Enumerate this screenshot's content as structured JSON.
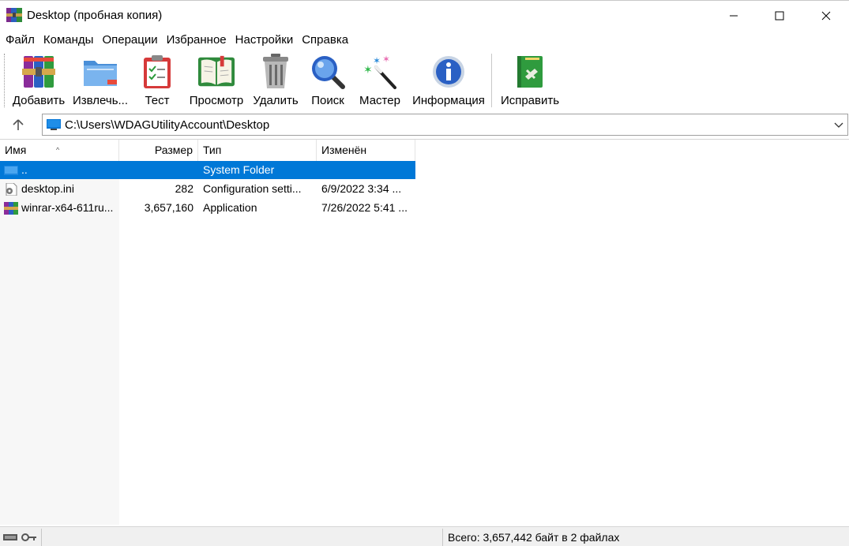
{
  "window": {
    "title": "Desktop (пробная копия)"
  },
  "menu": [
    "Файл",
    "Команды",
    "Операции",
    "Избранное",
    "Настройки",
    "Справка"
  ],
  "toolbar": {
    "add": "Добавить",
    "extract": "Извлечь...",
    "test": "Тест",
    "view": "Просмотр",
    "delete": "Удалить",
    "find": "Поиск",
    "wizard": "Мастер",
    "info": "Информация",
    "repair": "Исправить"
  },
  "address": {
    "path": "C:\\Users\\WDAGUtilityAccount\\Desktop"
  },
  "columns": {
    "name": "Имя",
    "size": "Размер",
    "type": "Тип",
    "modified": "Изменён"
  },
  "rows": [
    {
      "name": "..",
      "size": "",
      "type": "System Folder",
      "modified": "",
      "icon": "folder-icon",
      "selected": true
    },
    {
      "name": "desktop.ini",
      "size": "282",
      "type": "Configuration setti...",
      "modified": "6/9/2022 3:34 ...",
      "icon": "settings-file-icon",
      "selected": false
    },
    {
      "name": "winrar-x64-611ru...",
      "size": "3,657,160",
      "type": "Application",
      "modified": "7/26/2022 5:41 ...",
      "icon": "winrar-app-icon",
      "selected": false
    }
  ],
  "status": {
    "summary": "Всего: 3,657,442 байт в 2 файлах"
  },
  "colors": {
    "selection": "#0078d7",
    "window_bg": "#ffffff",
    "statusbar_bg": "#f0f0f0"
  }
}
